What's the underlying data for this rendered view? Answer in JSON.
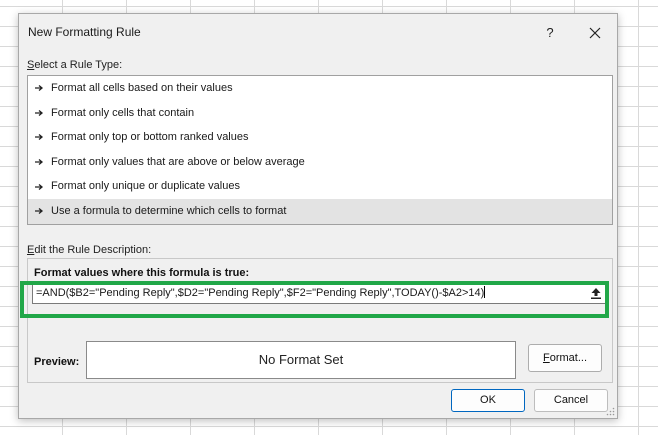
{
  "dialog": {
    "title": "New Formatting Rule",
    "help_label": "?",
    "close_icon": "close-x-icon"
  },
  "rule_type": {
    "label_first": "S",
    "label_rest": "elect a Rule Type:",
    "items": [
      {
        "label": "Format all cells based on their values",
        "selected": false
      },
      {
        "label": "Format only cells that contain",
        "selected": false
      },
      {
        "label": "Format only top or bottom ranked values",
        "selected": false
      },
      {
        "label": "Format only values that are above or below average",
        "selected": false
      },
      {
        "label": "Format only unique or duplicate values",
        "selected": false
      },
      {
        "label": "Use a formula to determine which cells to format",
        "selected": true
      }
    ],
    "item_icon": "arrow-right-icon"
  },
  "description": {
    "label_first": "E",
    "label_rest": "dit the Rule Description:",
    "formula_label": "Format values where this formula is true:",
    "formula_value": "=AND($B2=\"Pending Reply\",$D2=\"Pending Reply\",$F2=\"Pending Reply\",TODAY()-$A2>14)",
    "collapse_icon": "collapse-dialog-icon",
    "highlight_color": "#21a748"
  },
  "preview": {
    "label": "Preview:",
    "text": "No Format Set",
    "format_button_first": "F",
    "format_button_rest": "ormat..."
  },
  "buttons": {
    "ok": "OK",
    "cancel": "Cancel"
  },
  "colors": {
    "dialog_bg": "#f0f0f0",
    "selected_row": "#e3e3e3",
    "ok_border": "#0067c0"
  }
}
